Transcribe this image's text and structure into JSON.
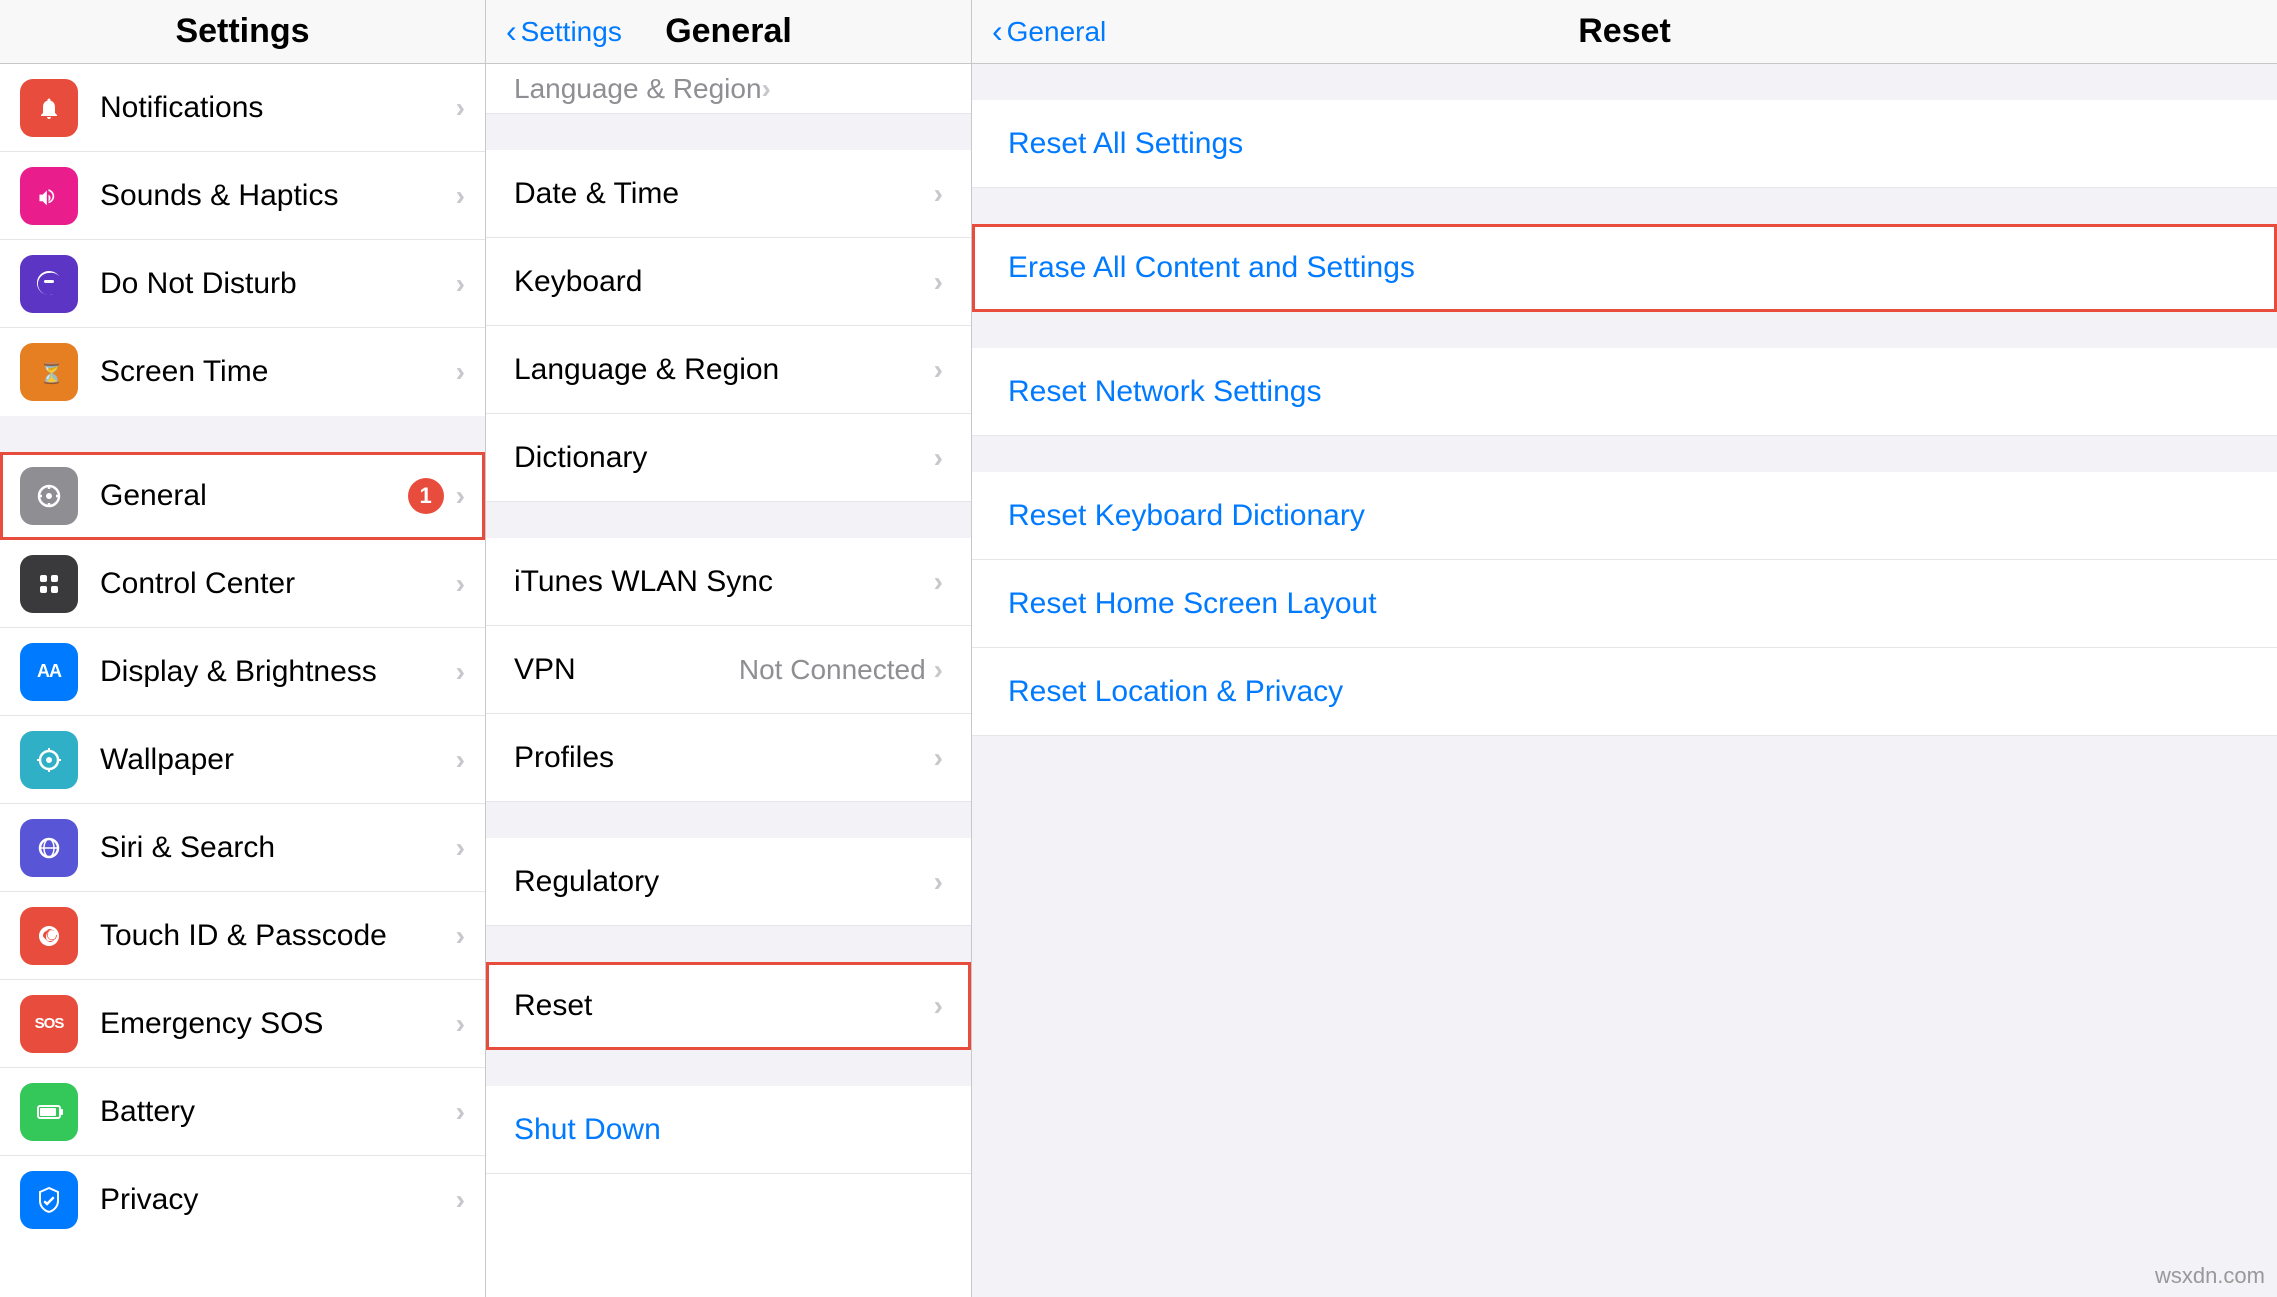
{
  "settings_column": {
    "title": "Settings",
    "items_group1": [
      {
        "id": "notifications",
        "label": "Notifications",
        "icon_bg": "bg-red",
        "icon": "🔔",
        "badge": null,
        "highlighted": false
      },
      {
        "id": "sounds",
        "label": "Sounds & Haptics",
        "icon_bg": "bg-pink",
        "icon": "🔊",
        "badge": null,
        "highlighted": false
      },
      {
        "id": "dnd",
        "label": "Do Not Disturb",
        "icon_bg": "bg-purple",
        "icon": "🌙",
        "badge": null,
        "highlighted": false
      },
      {
        "id": "screentime",
        "label": "Screen Time",
        "icon_bg": "bg-orange",
        "icon": "⏳",
        "badge": null,
        "highlighted": false
      }
    ],
    "items_group2": [
      {
        "id": "general",
        "label": "General",
        "icon_bg": "bg-gray",
        "icon": "⚙️",
        "badge": "1",
        "highlighted": true
      },
      {
        "id": "controlcenter",
        "label": "Control Center",
        "icon_bg": "bg-dark",
        "icon": "⊞",
        "badge": null,
        "highlighted": false
      },
      {
        "id": "displaybrightness",
        "label": "Display & Brightness",
        "icon_bg": "bg-blue",
        "icon": "AA",
        "badge": null,
        "highlighted": false
      },
      {
        "id": "wallpaper",
        "label": "Wallpaper",
        "icon_bg": "bg-teal",
        "icon": "✿",
        "badge": null,
        "highlighted": false
      },
      {
        "id": "siri",
        "label": "Siri & Search",
        "icon_bg": "bg-indigo",
        "icon": "◉",
        "badge": null,
        "highlighted": false
      },
      {
        "id": "touchid",
        "label": "Touch ID & Passcode",
        "icon_bg": "bg-red",
        "icon": "👆",
        "badge": null,
        "highlighted": false
      },
      {
        "id": "emergencysos",
        "label": "Emergency SOS",
        "icon_bg": "bg-red-sos",
        "icon": "SOS",
        "badge": null,
        "highlighted": false
      },
      {
        "id": "battery",
        "label": "Battery",
        "icon_bg": "bg-green",
        "icon": "🔋",
        "badge": null,
        "highlighted": false
      },
      {
        "id": "privacy",
        "label": "Privacy",
        "icon_bg": "bg-blue",
        "icon": "✋",
        "badge": null,
        "highlighted": false
      }
    ]
  },
  "general_column": {
    "header_back": "Settings",
    "header_title": "General",
    "partial_item": "Language & Region",
    "items_group1": [
      {
        "id": "datetime",
        "label": "Date & Time",
        "value": null
      },
      {
        "id": "keyboard",
        "label": "Keyboard",
        "value": null
      },
      {
        "id": "language",
        "label": "Language & Region",
        "value": null
      },
      {
        "id": "dictionary",
        "label": "Dictionary",
        "value": null
      }
    ],
    "items_group2": [
      {
        "id": "ituneswlan",
        "label": "iTunes WLAN Sync",
        "value": null
      },
      {
        "id": "vpn",
        "label": "VPN",
        "value": "Not Connected"
      },
      {
        "id": "profiles",
        "label": "Profiles",
        "value": null
      }
    ],
    "items_group3": [
      {
        "id": "regulatory",
        "label": "Regulatory",
        "value": null
      }
    ],
    "items_group4": [
      {
        "id": "reset",
        "label": "Reset",
        "value": null,
        "highlighted": true
      }
    ],
    "shutdown": {
      "id": "shutdown",
      "label": "Shut Down"
    }
  },
  "reset_column": {
    "header_back": "General",
    "header_title": "Reset",
    "items": [
      {
        "id": "reset-all-settings",
        "label": "Reset All Settings",
        "highlighted": false
      },
      {
        "id": "erase-all",
        "label": "Erase All Content and Settings",
        "highlighted": true
      },
      {
        "id": "reset-network",
        "label": "Reset Network Settings",
        "highlighted": false
      },
      {
        "id": "reset-keyboard",
        "label": "Reset Keyboard Dictionary",
        "highlighted": false
      },
      {
        "id": "reset-homescreen",
        "label": "Reset Home Screen Layout",
        "highlighted": false
      },
      {
        "id": "reset-location",
        "label": "Reset Location & Privacy",
        "highlighted": false
      }
    ]
  },
  "watermark": "wsxdn.com"
}
